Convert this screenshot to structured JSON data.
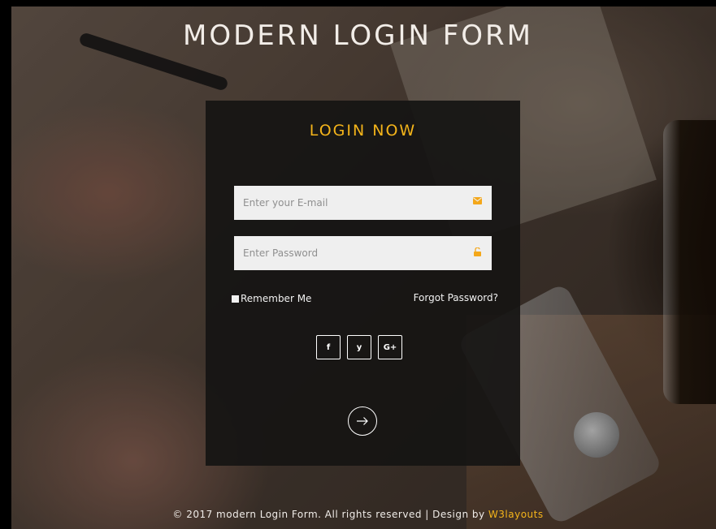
{
  "page": {
    "title": "MODERN LOGIN FORM",
    "accent_color": "#f4b41a"
  },
  "login_card": {
    "heading": "LOGIN NOW",
    "email": {
      "placeholder": "Enter your E-mail",
      "value": "",
      "icon": "envelope-icon"
    },
    "password": {
      "placeholder": "Enter Password",
      "value": "",
      "icon": "lock-icon"
    },
    "remember_label": "Remember Me",
    "forgot_label": "Forgot Password?",
    "socials": [
      {
        "label": "f",
        "icon": "facebook-icon"
      },
      {
        "label": "y",
        "icon": "twitter-icon"
      },
      {
        "label": "G+",
        "icon": "google-plus-icon"
      }
    ],
    "submit_icon": "arrow-right-icon"
  },
  "footer": {
    "text": "© 2017 modern Login Form. All rights reserved | Design by ",
    "brand": "W3layouts"
  }
}
